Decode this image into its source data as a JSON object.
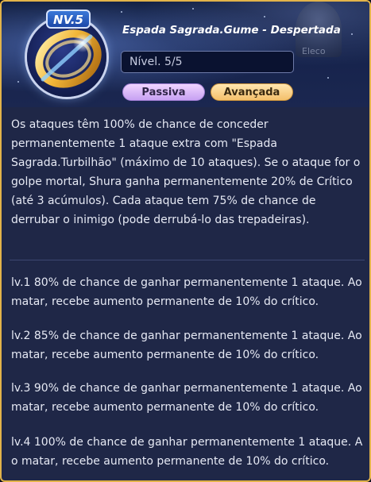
{
  "header": {
    "level_badge": "NV.5",
    "title": "Espada Sagrada.Gume - Despertada",
    "level_field": "Nível. 5/5",
    "side_label": "Eleco"
  },
  "tabs": [
    {
      "label": "Passiva"
    },
    {
      "label": "Avançada"
    }
  ],
  "description": "Os ataques têm 100% de chance de conceder permanentemente 1 ataque extra com \"Espada Sagrada.Turbilhão\" (máximo de 10 ataques). Se o ataque for o golpe mortal, Shura ganha permanentemente 20% de Crítico (até 3 acúmulos). Cada ataque tem 75% de chance de derrubar o inimigo (pode derrubá-lo das trepadeiras).",
  "levels": [
    {
      "text": "lv.1 80% de chance de ganhar permanentemente 1 ataque. Ao matar, recebe aumento permanente de 10% do crítico."
    },
    {
      "text": "lv.2 85% de chance de ganhar permanentemente 1 ataque. Ao matar, recebe aumento permanente de 10% do crítico."
    },
    {
      "text": "lv.3 90% de chance de ganhar permanentemente 1 ataque. Ao matar, recebe aumento permanente de 10% do crítico."
    },
    {
      "text": "lv.4 100% de chance de ganhar permanentemente 1 ataque. A o matar, recebe aumento permanente de 10% do crítico."
    }
  ],
  "colors": {
    "frame_border": "#e2b34a",
    "panel_bg": "#1f2747",
    "text": "#e6e9f4",
    "tab_passiva": "#d8b8f7",
    "tab_avancada": "#f6cd7f"
  },
  "icons": {
    "skill": "golden-ring-sword-icon"
  }
}
